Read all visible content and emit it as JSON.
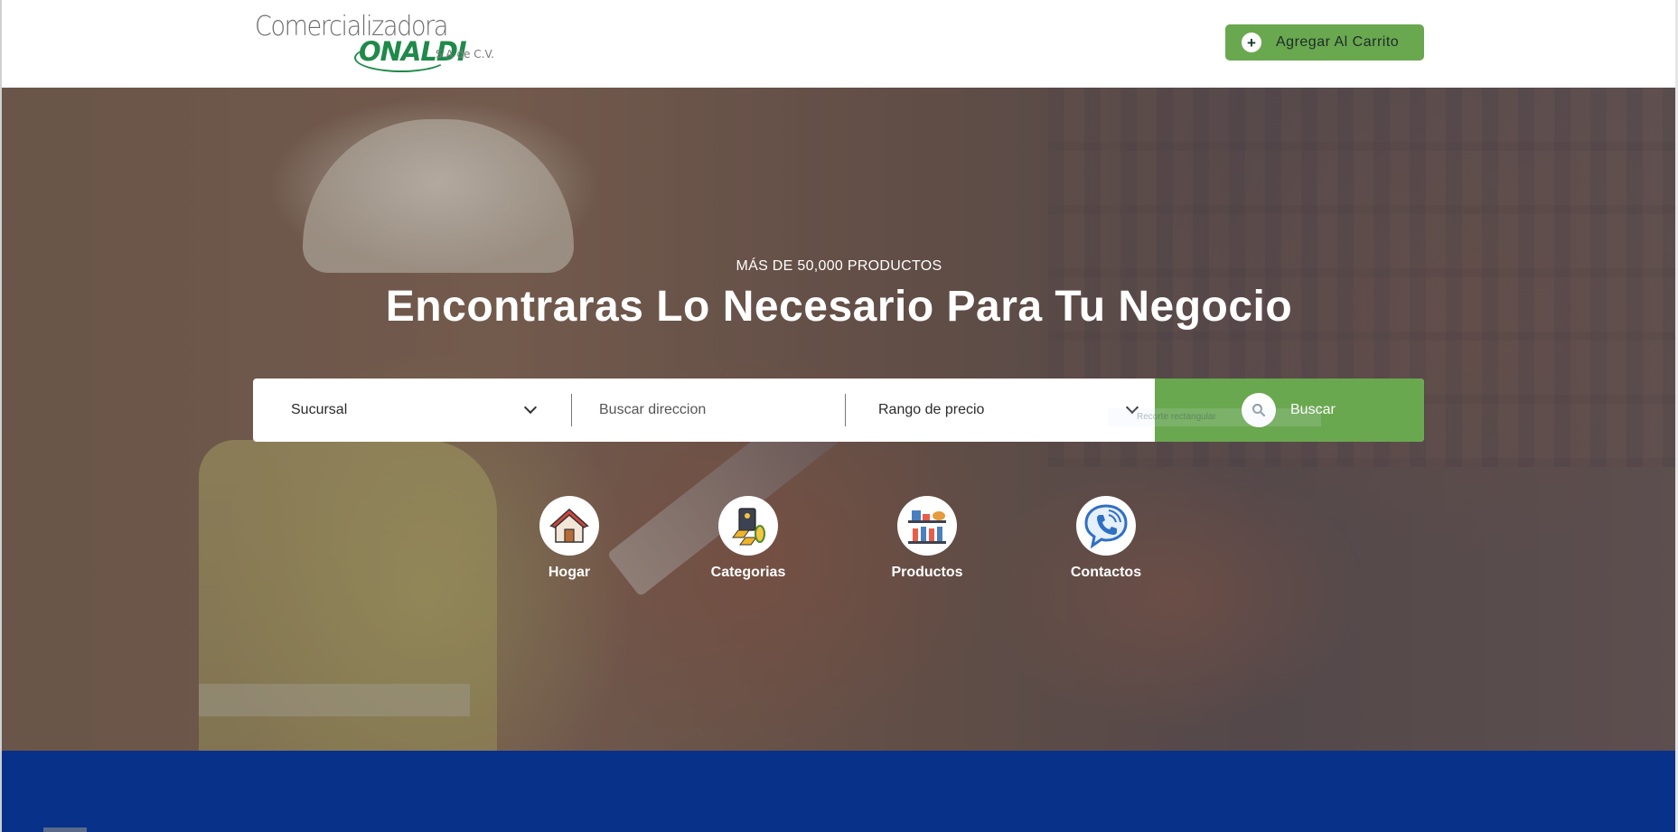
{
  "header": {
    "logo": {
      "line1": "Comercializadora",
      "line2": "ONALDI",
      "suffix": "S.A de C.V."
    },
    "cart_button": {
      "label": "Agregar Al Carrito",
      "icon": "plus-icon"
    }
  },
  "hero": {
    "eyebrow": "MÁS DE 50,000 PRODUCTOS",
    "headline": "Encontraras Lo Necesario Para Tu Negocio"
  },
  "search": {
    "branch_select": {
      "label": "Sucursal",
      "icon": "chevron-down-icon"
    },
    "address_input": {
      "placeholder": "Buscar direccion"
    },
    "price_select": {
      "label": "Rango de precio",
      "icon": "chevron-down-icon"
    },
    "button_label": "Buscar",
    "button_icon": "search-icon",
    "faint_overlay_text": "Recorte rectangular"
  },
  "quick_links": [
    {
      "label": "Hogar",
      "icon": "house-icon"
    },
    {
      "label": "Categorias",
      "icon": "categories-icon"
    },
    {
      "label": "Productos",
      "icon": "products-shelf-icon"
    },
    {
      "label": "Contactos",
      "icon": "phone-chat-icon"
    }
  ],
  "colors": {
    "brand_green": "#6aa84f",
    "logo_green": "#1f8a4a",
    "footer_blue": "#08318a"
  }
}
